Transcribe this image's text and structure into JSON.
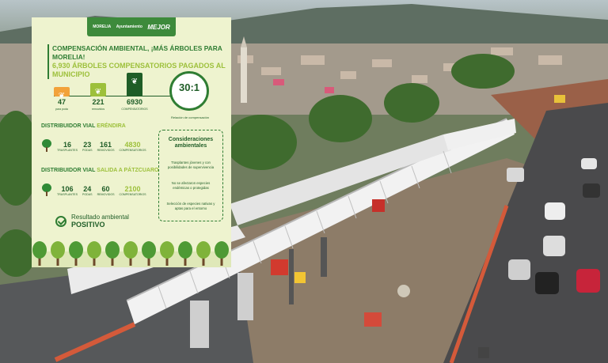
{
  "header": {
    "logo_left": "MORELIA",
    "logo_mid": "Ayuntamiento",
    "logo_right": "MEJOR"
  },
  "title": {
    "line1": "COMPENSACIÓN AMBIENTAL, ¡MÁS ÁRBOLES PARA MORELIA!",
    "line2": "6,930 ÁRBOLES COMPENSATORIOS PAGADOS AL MUNICIPIO"
  },
  "totals": [
    {
      "value": "47",
      "label": "para poda",
      "color": "#f2a23a",
      "level": 0.12
    },
    {
      "value": "221",
      "label": "removidos",
      "color": "#9dc03b",
      "level": 0.55
    },
    {
      "value": "6930",
      "label": "COMPENSATORIOS",
      "color": "#1f5d27",
      "level": 1.0
    }
  ],
  "ratio": {
    "value": "30:1",
    "label": "Relación de compensación"
  },
  "distributor1": {
    "label_prefix": "DISTRIBUIDOR VIAL",
    "label_name": "ERÉNDIRA",
    "stats": [
      {
        "value": "16",
        "label": "TRASPLANTES"
      },
      {
        "value": "23",
        "label": "PODAS"
      },
      {
        "value": "161",
        "label": "REMOVIDOS"
      },
      {
        "value": "4830",
        "label": "COMPENSATORIOS"
      }
    ]
  },
  "distributor2": {
    "label_prefix": "DISTRIBUIDOR VIAL",
    "label_name": "SALIDA A PÁTZCUARO",
    "stats": [
      {
        "value": "106",
        "label": "TRASPLANTES"
      },
      {
        "value": "24",
        "label": "PODAS"
      },
      {
        "value": "60",
        "label": "REMOVIDOS"
      },
      {
        "value": "2100",
        "label": "COMPENSATORIOS"
      }
    ]
  },
  "considerations": {
    "title": "Consideraciones ambientales",
    "items": [
      "Trasplantes jóvenes y con posibilidades de supervivencia",
      "No se afectaron especies endémicas o protegidas",
      "Selección de especies nativas y aptas para el entorno"
    ]
  },
  "result": {
    "line1": "Resultado ambiental",
    "line2": "POSITIVO"
  },
  "colors": {
    "green_dark": "#1f5d27",
    "green": "#2f7d33",
    "lime": "#9dc03b",
    "orange": "#f2a23a",
    "card_bg": "#eef3cf"
  }
}
